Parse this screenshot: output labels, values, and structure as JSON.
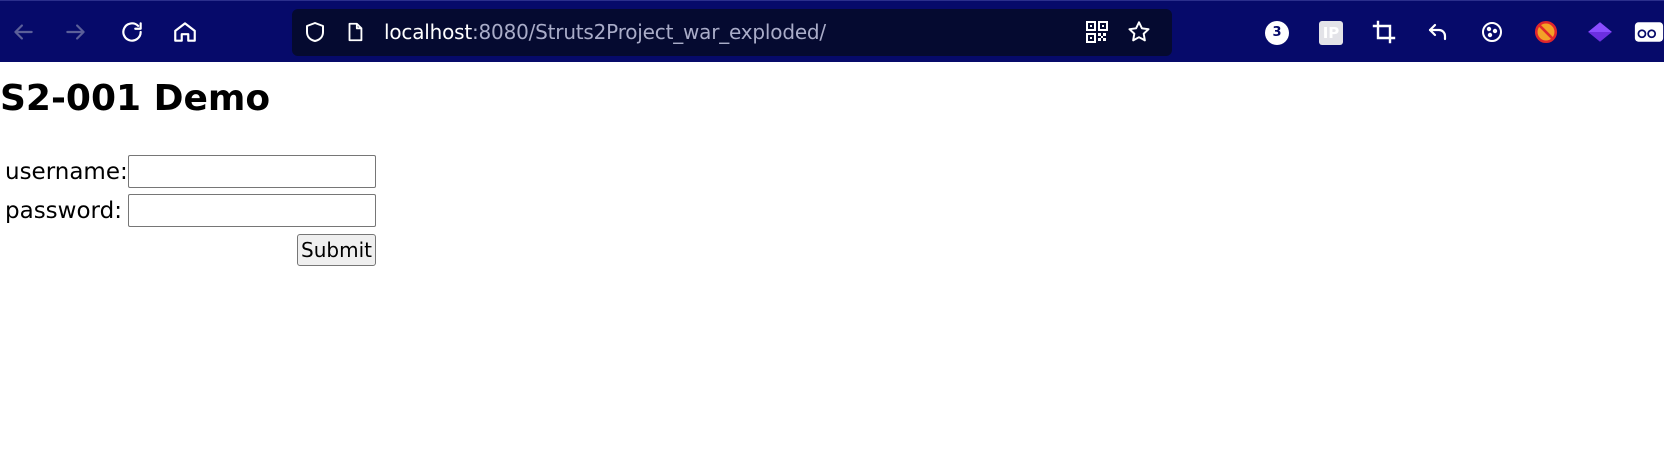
{
  "browser": {
    "url": {
      "host": "localhost",
      "path": ":8080/Struts2Project_war_exploded/"
    },
    "toolbar_icons": [
      "back-icon",
      "forward-icon",
      "reload-icon",
      "home-icon",
      "shield-icon",
      "page-icon",
      "qr-code-icon",
      "bookmark-star-icon"
    ],
    "extensions": {
      "badge_count": "3",
      "ip_label": "IP",
      "icons": [
        "crop-icon",
        "undo-arrow-icon",
        "cookie-icon",
        "blocked-extension-icon",
        "diamond-extension-icon",
        "glasses-extension-icon"
      ]
    },
    "colors": {
      "toolbar_bg": "#060a6a",
      "urlbar_bg": "#050a30"
    }
  },
  "page": {
    "title": "S2-001 Demo",
    "form": {
      "username_label": "username:",
      "username_value": "",
      "password_label": "password:",
      "password_value": "",
      "submit_label": "Submit"
    }
  }
}
